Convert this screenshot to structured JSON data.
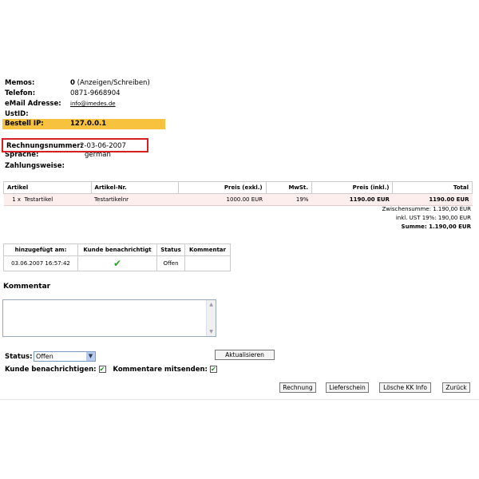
{
  "customer_info": {
    "memos_label": "Memos:",
    "memos_count": "0",
    "memos_action": "(Anzeigen/Schreiben)",
    "phone_label": "Telefon:",
    "phone_value": "0871-9668904",
    "email_label": "eMail Adresse:",
    "email_value": "info@imedes.de",
    "ustid_label": "UstID:",
    "ustid_value": "",
    "ip_label": "Bestell IP:",
    "ip_value": "127.0.0.1",
    "invoice_label": "Rechnungsnummer:",
    "invoice_value": "2-03-06-2007",
    "language_label": "Sprache:",
    "language_value": "german",
    "payment_label": "Zahlungsweise:",
    "payment_value": ""
  },
  "products": {
    "headers": [
      "Artikel",
      "Artikel-Nr.",
      "Preis (exkl.)",
      "MwSt.",
      "Preis (inkl.)",
      "Total"
    ],
    "rows": [
      {
        "qty": "1 x",
        "name": "Testartikel",
        "sku": "Testartikelnr",
        "price_excl": "1000.00 EUR",
        "tax": "19%",
        "price_incl": "1190.00 EUR",
        "total": "1190.00 EUR"
      }
    ]
  },
  "totals": {
    "subtotal": "Zwischensumme: 1.190,00 EUR",
    "tax": "inkl. UST 19%:   190,00 EUR",
    "sum_label": "Summe:",
    "sum_value": "1.190,00 EUR"
  },
  "history": {
    "headers": [
      "hinzugefügt am:",
      "Kunde benachrichtigt",
      "Status",
      "Kommentar"
    ],
    "rows": [
      {
        "date": "03.06.2007 16:57:42",
        "notified": "✔",
        "status": "Offen",
        "comment": ""
      }
    ]
  },
  "comment_section": {
    "title": "Kommentar",
    "value": ""
  },
  "status_form": {
    "status_label": "Status:",
    "status_selected": "Offen",
    "update_button": "Aktualisieren",
    "notify_label": "Kunde benachrichtigen:",
    "notify_checked": "✔",
    "send_comments_label": "Kommentare mitsenden:",
    "send_comments_checked": "✔"
  },
  "actions": {
    "invoice": "Rechnung",
    "delivery_note": "Lieferschein",
    "delete_cc": "Lösche KK Info",
    "back": "Zurück"
  },
  "colors": {
    "ip_highlight": "#f7c23e",
    "invoice_border": "#d42020",
    "row_bg": "#fdeeee",
    "check_green": "#2aa12a"
  }
}
